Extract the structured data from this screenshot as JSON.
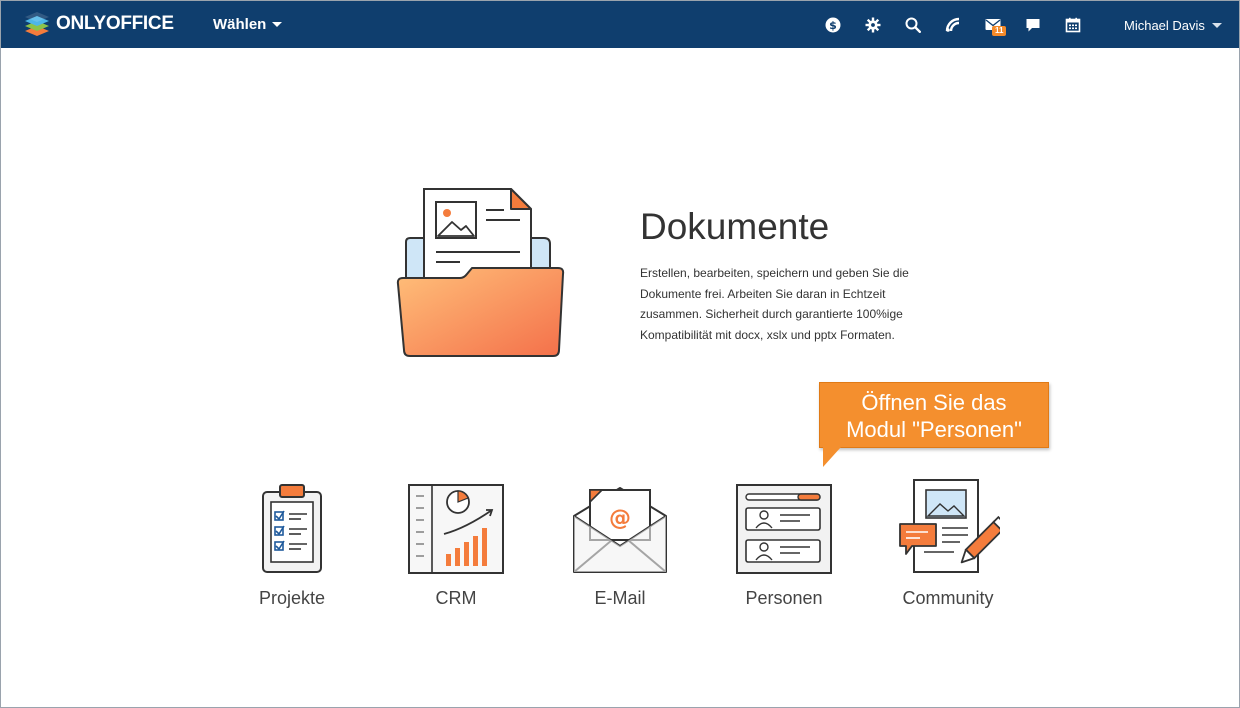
{
  "header": {
    "logo_text": "ONLYOFFICE",
    "module_select_label": "Wählen",
    "icons": [
      "payments-icon",
      "settings-icon",
      "search-icon",
      "feed-icon",
      "mail-icon",
      "chat-icon",
      "calendar-icon"
    ],
    "mail_badge": "11",
    "user_name": "Michael Davis",
    "background_color": "#0f3e6e"
  },
  "hero": {
    "title": "Dokumente",
    "description": "Erstellen, bearbeiten, speichern und geben Sie die Dokumente frei. Arbeiten Sie daran in Echtzeit zusammen. Sicherheit durch garantierte 100%ige Kompatibilität mit docx, xslx und pptx Formaten.",
    "icon": "documents-folder-icon"
  },
  "tooltip": {
    "text_line1": "Öffnen Sie das",
    "text_line2": "Modul \"Personen\"",
    "color": "#f48f2e"
  },
  "modules": [
    {
      "label": "Projekte",
      "icon": "projects-clipboard-icon"
    },
    {
      "label": "CRM",
      "icon": "crm-chart-icon"
    },
    {
      "label": "E-Mail",
      "icon": "mail-envelope-icon"
    },
    {
      "label": "Personen",
      "icon": "people-cards-icon"
    },
    {
      "label": "Community",
      "icon": "community-icon"
    }
  ],
  "accent_color": "#f47c3c"
}
